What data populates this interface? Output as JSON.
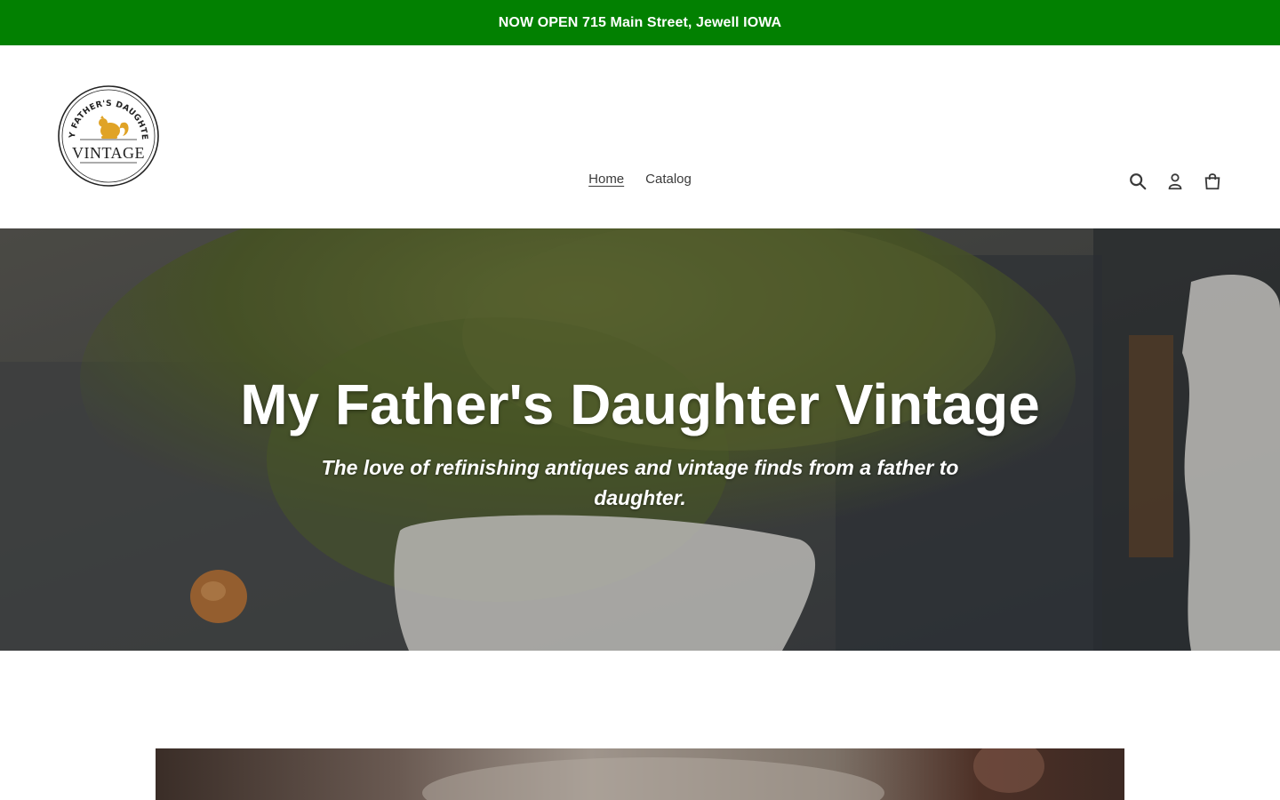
{
  "announcement": {
    "text": "NOW OPEN 715 Main Street, Jewell IOWA"
  },
  "header": {
    "logo": {
      "arc_text": "MY FATHER'S DAUGHTER",
      "wordmark": "VINTAGE",
      "icon": "squirrel-icon",
      "colors": {
        "ring": "#222222",
        "squirrel": "#e0a326"
      }
    },
    "nav": {
      "items": [
        {
          "label": "Home",
          "active": true
        },
        {
          "label": "Catalog",
          "active": false
        }
      ]
    },
    "icons": {
      "search": "search-icon",
      "account": "user-icon",
      "cart": "shopping-bag-icon"
    }
  },
  "hero": {
    "title": "My Father's Daughter Vintage",
    "subtitle": "The love of refinishing antiques and vintage finds from a father to daughter."
  },
  "colors": {
    "announcement_bg": "#028001",
    "text": "#3a3a3a",
    "hero_text": "#ffffff"
  }
}
